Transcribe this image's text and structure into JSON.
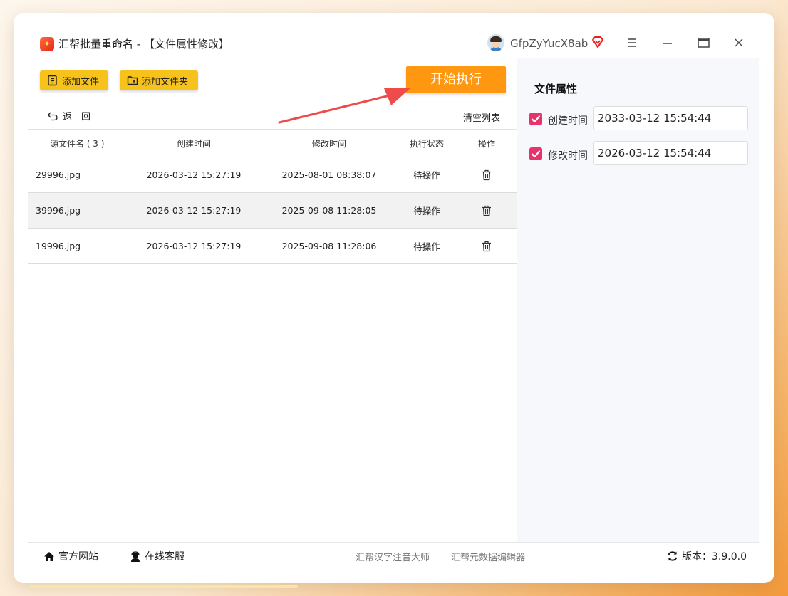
{
  "titlebar": {
    "title": "汇帮批量重命名 - 【文件属性修改】",
    "username": "GfpZyYucX8ab"
  },
  "toolbar": {
    "add_file_label": "添加文件",
    "add_folder_label": "添加文件夹",
    "start_label": "开始执行",
    "back_label": "返　回",
    "clear_label": "清空列表"
  },
  "table": {
    "headers": {
      "name": "源文件名 ( 3 )",
      "ctime": "创建时间",
      "mtime": "修改时间",
      "status": "执行状态",
      "op": "操作"
    },
    "rows": [
      {
        "name": "29996.jpg",
        "ctime": "2026-03-12 15:27:19",
        "mtime": "2025-08-01 08:38:07",
        "status": "待操作"
      },
      {
        "name": "39996.jpg",
        "ctime": "2026-03-12 15:27:19",
        "mtime": "2025-09-08 11:28:05",
        "status": "待操作"
      },
      {
        "name": "19996.jpg",
        "ctime": "2026-03-12 15:27:19",
        "mtime": "2025-09-08 11:28:06",
        "status": "待操作"
      }
    ]
  },
  "attributes": {
    "title": "文件属性",
    "create_label": "创建时间",
    "create_value": "2033-03-12 15:54:44",
    "create_checked": true,
    "modify_label": "修改时间",
    "modify_value": "2026-03-12 15:54:44",
    "modify_checked": true
  },
  "footer": {
    "website": "官方网站",
    "support": "在线客服",
    "link1": "汇帮汉字注音大师",
    "link2": "汇帮元数据编辑器",
    "version": "版本：3.9.0.0"
  },
  "colors": {
    "accent_yellow": "#f7c21b",
    "start_orange": "#ff9810",
    "checkbox_pink": "#e8326b",
    "arrow_red": "#ef4b4b"
  }
}
